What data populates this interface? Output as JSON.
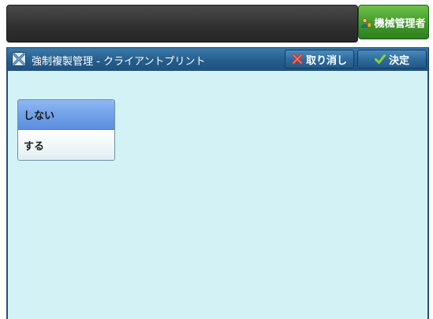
{
  "top_bar": {
    "admin_button_label": "機械管理者",
    "admin_icon": "admin-user-icon",
    "admin_color": "#3f9a2c"
  },
  "header": {
    "title": "強制複製管理 - クライアントプリント",
    "title_icon": "tool-icon",
    "cancel_label": "取り消し",
    "cancel_icon": "x-mark-icon",
    "ok_label": "決定",
    "ok_icon": "checkmark-icon",
    "bar_color": "#245d8b"
  },
  "options": [
    {
      "label": "しない",
      "selected": true
    },
    {
      "label": "する",
      "selected": false
    }
  ],
  "content_background": "#d2f2f6"
}
